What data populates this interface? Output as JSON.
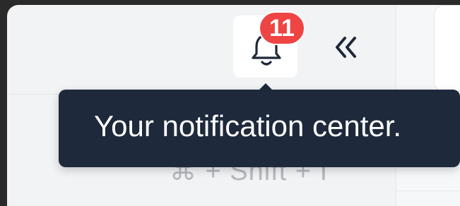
{
  "notifications": {
    "badge_count": "11",
    "tooltip_text": "Your notification center."
  },
  "shortcut": {
    "hint": "⌘ + Shift + I"
  },
  "icons": {
    "bell": "bell-icon",
    "collapse": "chevrons-left-icon"
  },
  "colors": {
    "tooltip_bg": "#1e293b",
    "badge_bg": "#ef4444",
    "sidebar_bg": "#f1f3f4"
  }
}
